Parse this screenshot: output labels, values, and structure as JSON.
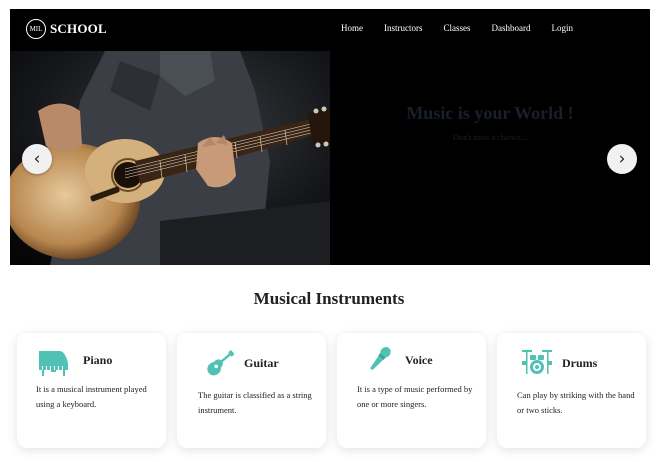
{
  "navbar": {
    "logo_text": "MIL",
    "brand": "SCHOOL",
    "links": [
      "Home",
      "Instructors",
      "Classes",
      "Dashboard",
      "Login"
    ]
  },
  "hero": {
    "title": "Music is your World !",
    "subtitle": "Don't miss a chance...",
    "prev_arrow": "‹",
    "next_arrow": "›"
  },
  "section": {
    "title": "Musical Instruments"
  },
  "cards": [
    {
      "title": "Piano",
      "icon": "piano-icon",
      "text": "It is a musical instrument played using a keyboard."
    },
    {
      "title": "Guitar",
      "icon": "guitar-icon",
      "text": "The guitar is classified as a string instrument."
    },
    {
      "title": "Voice",
      "icon": "microphone-icon",
      "text": "It is a type of music performed by one or more singers."
    },
    {
      "title": "Drums",
      "icon": "drums-icon",
      "text": "Can play by striking with the hand or two sticks."
    }
  ],
  "colors": {
    "accent": "#4fc1b5",
    "navbar": "#000000",
    "hero_text": "#1a1f2c"
  }
}
